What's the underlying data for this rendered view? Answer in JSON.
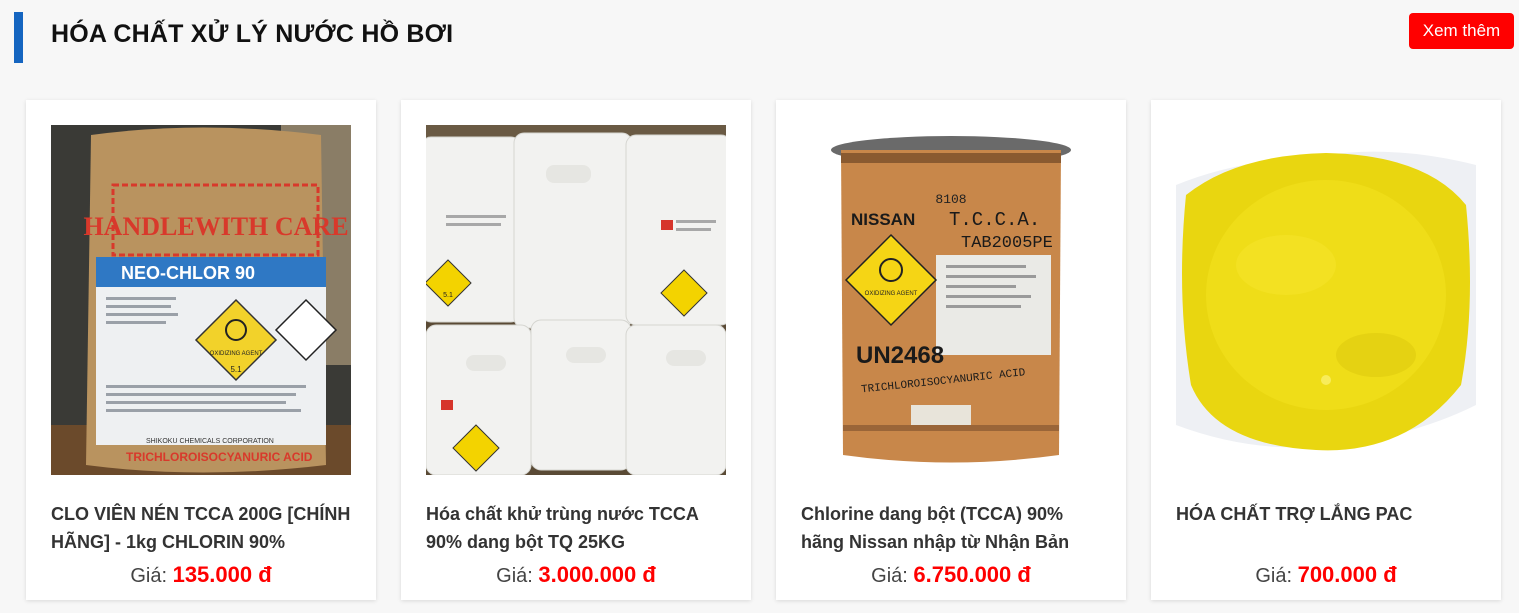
{
  "section": {
    "title": "HÓA CHẤT XỬ LÝ NƯỚC HỒ BƠI",
    "more_label": "Xem thêm"
  },
  "colors": {
    "accent": "#1565c0",
    "button": "#ff0000",
    "price": "#ff0000"
  },
  "products": [
    {
      "title": "CLO VIÊN NÉN TCCA 200G [CHÍNH HÃNG] - 1kg CHLORIN 90%",
      "price_label": "Giá:",
      "price": "135.000 đ",
      "image": {
        "handle": "HANDLEWITH CARE",
        "brand": "NEO-CHLOR 90",
        "hazard": "OXIDIZING AGENT",
        "class": "5.1",
        "maker": "SHIKOKU CHEMICALS CORPORATION",
        "chem": "TRICHLOROISOCYANURIC ACID"
      }
    },
    {
      "title": "Hóa chất khử trùng nước TCCA 90% dang bột TQ 25KG",
      "price_label": "Giá:",
      "price": "3.000.000 đ",
      "image": {
        "class": "5.1"
      }
    },
    {
      "title": "Chlorine dang bột (TCCA) 90% hãng Nissan nhập từ Nhận Bản",
      "price_label": "Giá:",
      "price": "6.750.000 đ",
      "image": {
        "code": "8108",
        "brand": "NISSAN",
        "product": "T.C.C.A.",
        "tab": "TAB2005PE",
        "un": "UN2468",
        "chem": "TRICHLOROISOCYANURIC ACID",
        "hazard": "OXIDIZING AGENT"
      }
    },
    {
      "title": "HÓA CHẤT TRỢ LẮNG PAC",
      "price_label": "Giá:",
      "price": "700.000 đ",
      "image": {}
    }
  ]
}
